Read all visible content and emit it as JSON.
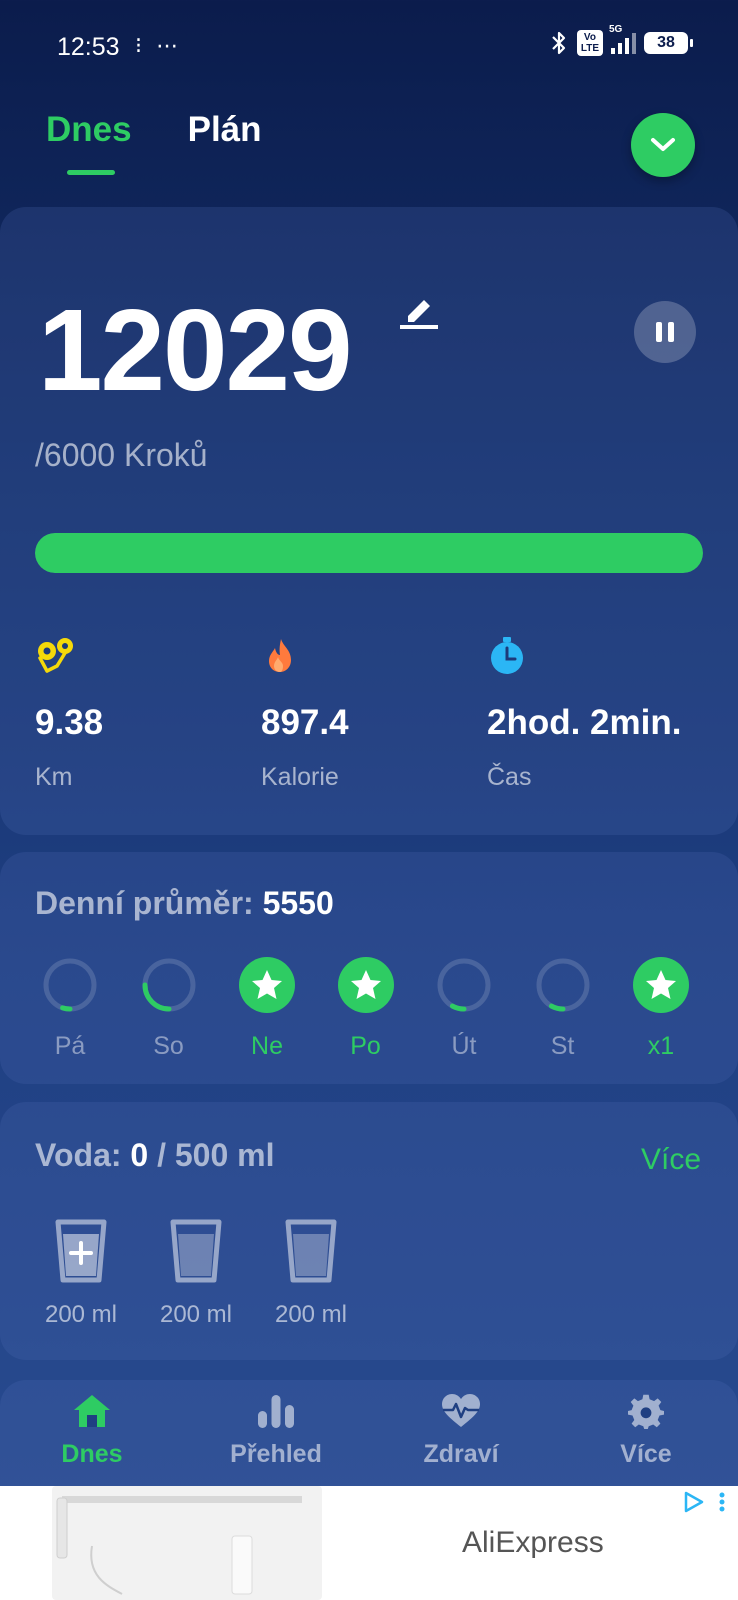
{
  "status_bar": {
    "time": "12:53",
    "left_icons": "⁝ ⋯",
    "volte": "Vo\nLTE",
    "network": "5G",
    "battery": "38"
  },
  "tabs": [
    {
      "label": "Dnes",
      "active": true
    },
    {
      "label": "Plán",
      "active": false
    }
  ],
  "steps": {
    "value": "12029",
    "goal_text": "/6000 Kroků",
    "progress": 1.0
  },
  "stats": {
    "distance": {
      "value": "9.38",
      "label": "Km",
      "icon": "distance-icon"
    },
    "calories": {
      "value": "897.4",
      "label": "Kalorie",
      "icon": "flame-icon"
    },
    "time": {
      "value": "2hod. 2min.",
      "label": "Čas",
      "icon": "stopwatch-icon"
    }
  },
  "daily_average": {
    "label": "Denní průměr:",
    "value": "5550",
    "days": [
      {
        "label": "Pá",
        "done": false,
        "progress": 0.05
      },
      {
        "label": "So",
        "done": false,
        "progress": 0.25
      },
      {
        "label": "Ne",
        "done": true,
        "progress": 1
      },
      {
        "label": "Po",
        "done": true,
        "progress": 1
      },
      {
        "label": "Út",
        "done": false,
        "progress": 0.08
      },
      {
        "label": "St",
        "done": false,
        "progress": 0.08
      },
      {
        "label": "x1",
        "done": true,
        "progress": 1
      }
    ]
  },
  "water": {
    "label": "Voda:",
    "current": "0",
    "target": "/ 500 ml",
    "more": "Více",
    "glasses": [
      "200 ml",
      "200 ml",
      "200 ml"
    ]
  },
  "bottom_nav": [
    {
      "label": "Dnes",
      "icon": "home-icon",
      "active": true
    },
    {
      "label": "Přehled",
      "icon": "bar-chart-icon",
      "active": false
    },
    {
      "label": "Zdraví",
      "icon": "heart-pulse-icon",
      "active": false
    },
    {
      "label": "Více",
      "icon": "gear-icon",
      "active": false
    }
  ],
  "ad": {
    "advertiser": "AliExpress"
  },
  "colors": {
    "accent": "#2ecc63",
    "background_top": "#0b1c4c",
    "background_bottom": "#2a4d92"
  }
}
